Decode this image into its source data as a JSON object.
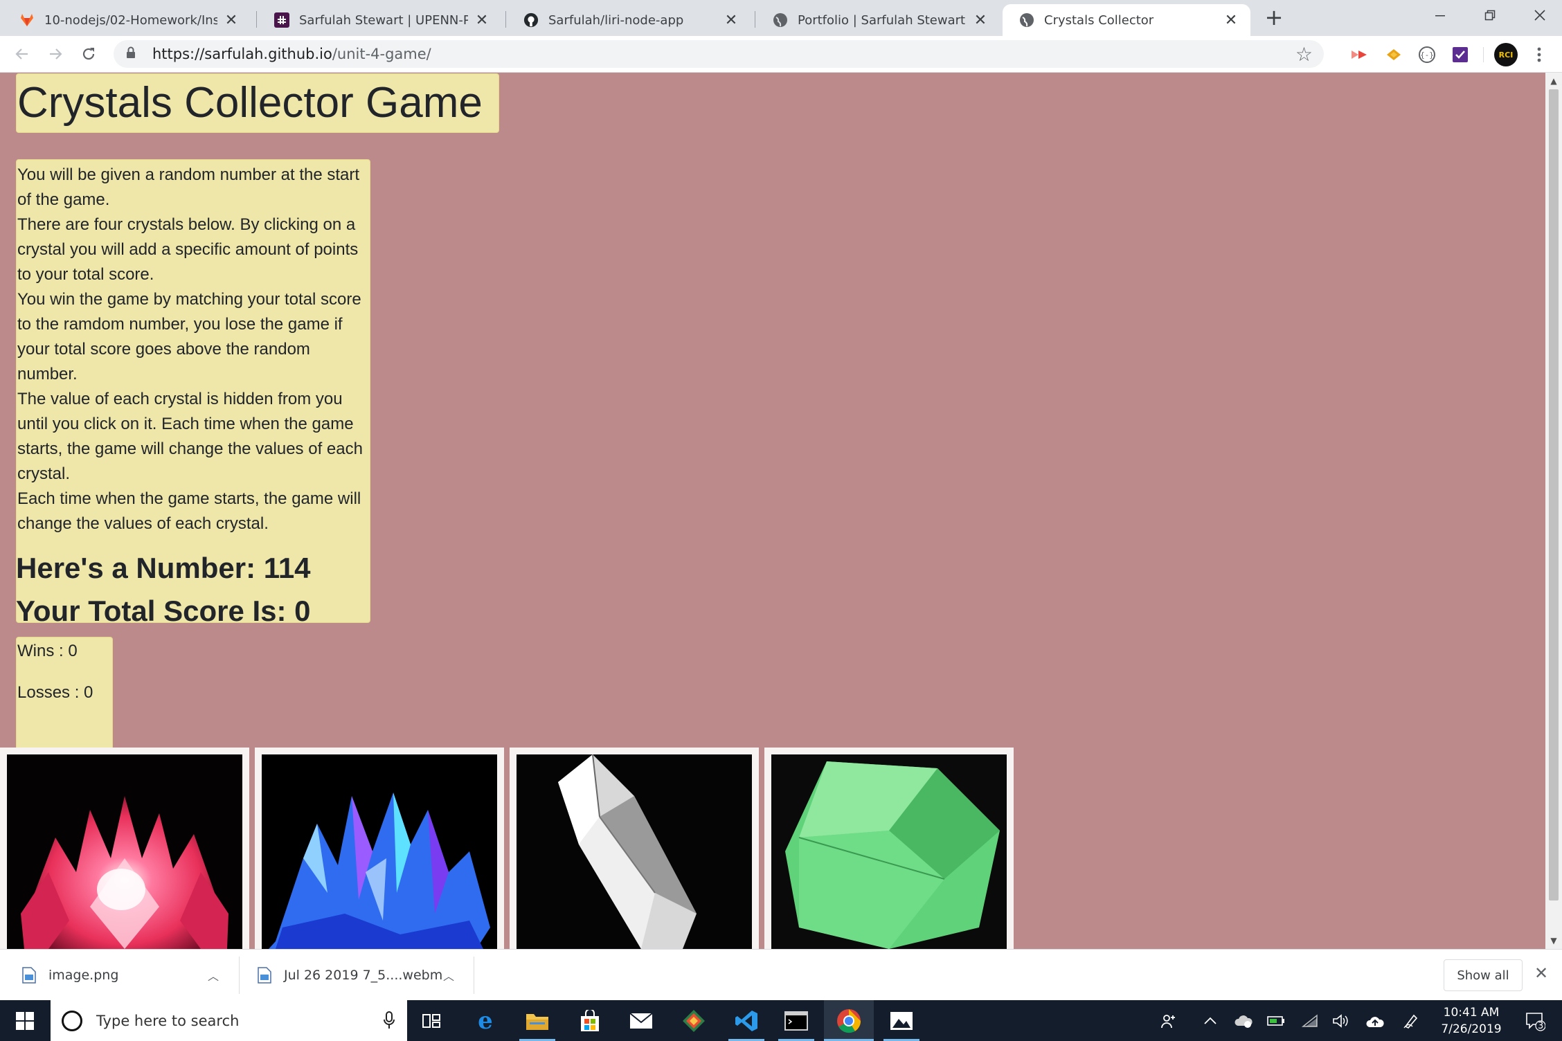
{
  "browser": {
    "tabs": [
      {
        "title": "10-nodejs/02-Homework/Instruc",
        "icon": "gitlab-fox-icon"
      },
      {
        "title": "Sarfulah Stewart | UPENN-PHI-FS",
        "icon": "slack-icon"
      },
      {
        "title": "Sarfulah/liri-node-app",
        "icon": "github-icon"
      },
      {
        "title": "Portfolio | Sarfulah Stewart",
        "icon": "globe-icon"
      },
      {
        "title": "Crystals Collector",
        "icon": "globe-icon"
      }
    ],
    "new_tab": "+",
    "close_glyph": "✕",
    "url_host": "https://sarfulah.github.io",
    "url_path": "/unit-4-game/",
    "profile_badge": "RCI"
  },
  "page": {
    "title": "Crystals Collector Game",
    "instructions": [
      "You will be given a random number at the start of the game.",
      "There are four crystals below. By clicking on a crystal you will add a specific amount of points to your total score.",
      "You win the game by matching your total score to the ramdom number, you lose the game if your total score goes above the random number.",
      "The value of each crystal is hidden from you until you click on it. Each time when the game starts, the game will change the values of each crystal.",
      "Each time when the game starts, the game will change the values of each crystal."
    ],
    "number_label": "Here's a Number: 114",
    "score_label": "Your Total Score Is: 0",
    "wins_label": "Wins : 0",
    "losses_label": "Losses : 0",
    "crystals": [
      {
        "name": "pink crystal",
        "color": "#e8305a"
      },
      {
        "name": "blue crystal",
        "color": "#2f6cf0"
      },
      {
        "name": "clear quartz crystal",
        "color": "#d8d8d8"
      },
      {
        "name": "green crystal",
        "color": "#5fd27a"
      }
    ],
    "background_color": "#bc8a8b",
    "box_color": "#efe6a9"
  },
  "downloads": {
    "items": [
      {
        "name": "image.png"
      },
      {
        "name": "Jul 26 2019 7_5....webm"
      }
    ],
    "show_all": "Show all"
  },
  "taskbar": {
    "search_placeholder": "Type here to search",
    "time": "10:41 AM",
    "date": "7/26/2019",
    "notification_count": "3"
  }
}
